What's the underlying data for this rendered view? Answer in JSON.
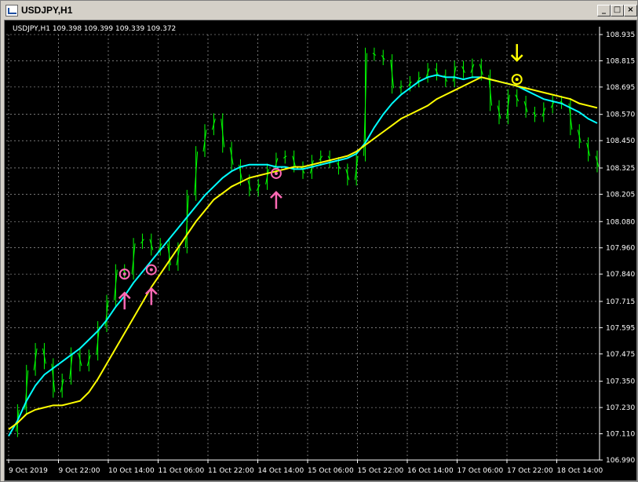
{
  "window": {
    "title": "USDJPY,H1",
    "minimize": "_",
    "maximize": "□",
    "close": "×"
  },
  "chart": {
    "header": "USDJPY,H1  109.398 109.399 109.339 109.372",
    "colors": {
      "background": "#000000",
      "grid": "#c0c0c0",
      "candles": "#00ff00",
      "ma_fast": "#00ffff",
      "ma_slow": "#ffff00",
      "buy_signal": "#ff69b4",
      "sell_signal": "#ffff00"
    }
  },
  "chart_data": {
    "type": "line",
    "title": "USDJPY,H1",
    "xlabel": "",
    "ylabel": "",
    "ylim": [
      106.99,
      108.935
    ],
    "x_ticks": [
      "9 Oct 2019",
      "9 Oct 22:00",
      "10 Oct 14:00",
      "11 Oct 06:00",
      "11 Oct 22:00",
      "14 Oct 14:00",
      "15 Oct 06:00",
      "15 Oct 22:00",
      "16 Oct 14:00",
      "17 Oct 06:00",
      "17 Oct 22:00",
      "18 Oct 14:00"
    ],
    "y_ticks": [
      "108.935",
      "108.815",
      "108.695",
      "108.570",
      "108.450",
      "108.325",
      "108.205",
      "108.080",
      "107.960",
      "107.840",
      "107.715",
      "107.595",
      "107.475",
      "107.350",
      "107.230",
      "107.110",
      "106.990"
    ],
    "series": [
      {
        "name": "",
        "values": [
          107.12,
          107.22,
          107.4,
          107.5,
          107.43,
          107.3,
          107.36,
          107.48,
          107.42,
          107.47,
          107.6,
          107.72,
          107.86,
          107.84,
          107.98,
          108.0,
          107.95,
          107.98,
          107.88,
          107.96,
          108.2,
          108.4,
          108.5,
          108.55,
          108.42,
          108.34,
          108.27,
          108.22,
          108.25,
          108.32,
          108.37,
          108.38,
          108.33,
          108.3,
          108.36,
          108.38,
          108.35,
          108.32,
          108.27,
          108.38,
          108.85,
          108.84,
          108.82,
          108.69,
          108.7,
          108.72,
          108.74,
          108.78,
          108.75,
          108.72,
          108.79,
          108.76,
          108.8,
          108.75,
          108.61,
          108.55,
          108.66,
          108.63,
          108.58,
          108.56,
          108.6,
          108.63,
          108.62,
          108.5,
          108.44,
          108.38,
          108.33
        ]
      },
      {
        "name": "",
        "values": [
          107.1,
          107.17,
          107.26,
          107.33,
          107.38,
          107.41,
          107.44,
          107.47,
          107.5,
          107.54,
          107.58,
          107.63,
          107.69,
          107.74,
          107.8,
          107.85,
          107.9,
          107.95,
          108.0,
          108.05,
          108.1,
          108.15,
          108.2,
          108.24,
          108.28,
          108.31,
          108.33,
          108.34,
          108.34,
          108.34,
          108.33,
          108.33,
          108.32,
          108.32,
          108.33,
          108.34,
          108.35,
          108.36,
          108.37,
          108.39,
          108.44,
          108.51,
          108.57,
          108.62,
          108.66,
          108.69,
          108.72,
          108.74,
          108.75,
          108.74,
          108.74,
          108.73,
          108.74,
          108.74,
          108.73,
          108.72,
          108.71,
          108.7,
          108.68,
          108.66,
          108.64,
          108.63,
          108.62,
          108.6,
          108.58,
          108.55,
          108.53
        ]
      },
      {
        "name": "",
        "values": [
          107.13,
          107.16,
          107.2,
          107.22,
          107.23,
          107.24,
          107.24,
          107.25,
          107.26,
          107.3,
          107.36,
          107.43,
          107.5,
          107.57,
          107.64,
          107.71,
          107.78,
          107.84,
          107.9,
          107.96,
          108.02,
          108.08,
          108.13,
          108.18,
          108.21,
          108.24,
          108.26,
          108.28,
          108.29,
          108.3,
          108.31,
          108.32,
          108.33,
          108.33,
          108.34,
          108.35,
          108.36,
          108.37,
          108.38,
          108.4,
          108.43,
          108.46,
          108.49,
          108.52,
          108.55,
          108.57,
          108.59,
          108.61,
          108.64,
          108.66,
          108.68,
          108.7,
          108.72,
          108.74,
          108.73,
          108.72,
          108.71,
          108.7,
          108.69,
          108.68,
          108.67,
          108.66,
          108.65,
          108.64,
          108.62,
          108.61,
          108.6
        ]
      }
    ],
    "grid": true,
    "signals": [
      {
        "type": "buy",
        "x_index": 13,
        "price": 107.84
      },
      {
        "type": "buy",
        "x_index": 16,
        "price": 107.86
      },
      {
        "type": "buy",
        "x_index": 30,
        "price": 108.3
      },
      {
        "type": "sell",
        "x_index": 57,
        "price": 108.73
      }
    ]
  }
}
